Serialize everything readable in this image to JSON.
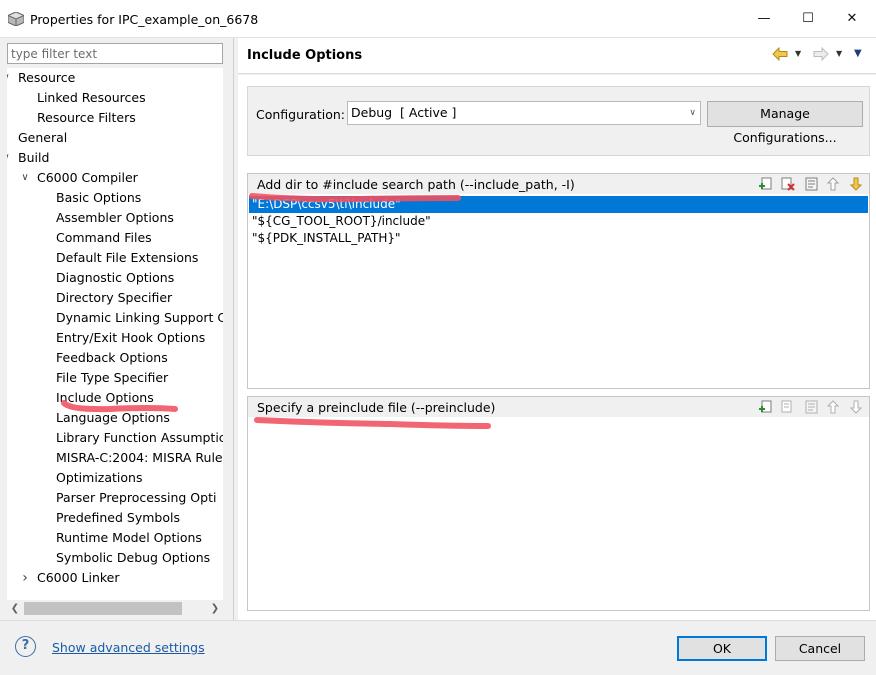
{
  "window": {
    "title": "Properties for IPC_example_on_6678",
    "minimize_glyph": "—",
    "maximize_glyph": "☐",
    "close_glyph": "✕"
  },
  "left": {
    "filter_placeholder": "type filter text",
    "tree": [
      {
        "label": "Resource",
        "level": 0,
        "expander": "expanded"
      },
      {
        "label": "Linked Resources",
        "level": 1,
        "expander": "none"
      },
      {
        "label": "Resource Filters",
        "level": 1,
        "expander": "none"
      },
      {
        "label": "General",
        "level": 0,
        "expander": "none"
      },
      {
        "label": "Build",
        "level": 0,
        "expander": "expanded"
      },
      {
        "label": "C6000 Compiler",
        "level": 1,
        "expander": "expanded"
      },
      {
        "label": "Basic Options",
        "level": 2,
        "expander": "none"
      },
      {
        "label": "Assembler Options",
        "level": 2,
        "expander": "none"
      },
      {
        "label": "Command Files",
        "level": 2,
        "expander": "none"
      },
      {
        "label": "Default File Extensions",
        "level": 2,
        "expander": "none"
      },
      {
        "label": "Diagnostic Options",
        "level": 2,
        "expander": "none"
      },
      {
        "label": "Directory Specifier",
        "level": 2,
        "expander": "none"
      },
      {
        "label": "Dynamic Linking Support C",
        "level": 2,
        "expander": "none"
      },
      {
        "label": "Entry/Exit Hook Options",
        "level": 2,
        "expander": "none"
      },
      {
        "label": "Feedback Options",
        "level": 2,
        "expander": "none"
      },
      {
        "label": "File Type Specifier",
        "level": 2,
        "expander": "none"
      },
      {
        "label": "Include Options",
        "level": 2,
        "expander": "none"
      },
      {
        "label": "Language Options",
        "level": 2,
        "expander": "none"
      },
      {
        "label": "Library Function Assumptic",
        "level": 2,
        "expander": "none"
      },
      {
        "label": "MISRA-C:2004: MISRA Rule",
        "level": 2,
        "expander": "none"
      },
      {
        "label": "Optimizations",
        "level": 2,
        "expander": "none"
      },
      {
        "label": "Parser Preprocessing Opti",
        "level": 2,
        "expander": "none"
      },
      {
        "label": "Predefined Symbols",
        "level": 2,
        "expander": "none"
      },
      {
        "label": "Runtime Model Options",
        "level": 2,
        "expander": "none"
      },
      {
        "label": "Symbolic Debug Options",
        "level": 2,
        "expander": "none"
      },
      {
        "label": "C6000 Linker",
        "level": 1,
        "expander": "collapsed"
      }
    ]
  },
  "right": {
    "page_title": "Include Options",
    "configuration": {
      "label": "Configuration:",
      "value": "Debug  [ Active ]",
      "manage_label": "Manage Configurations..."
    },
    "include_paths": {
      "title": "Add dir to #include search path (--include_path, -I)",
      "items": [
        "\"E:\\DSP\\ccsv5\\ti\\include\"",
        "\"${CG_TOOL_ROOT}/include\"",
        "\"${PDK_INSTALL_PATH}\""
      ],
      "selected_index": 0
    },
    "preinclude": {
      "title": "Specify a preinclude file (--preinclude)",
      "items": []
    }
  },
  "bottom": {
    "help_glyph": "?",
    "advanced_link": "Show advanced settings",
    "ok_label": "OK",
    "cancel_label": "Cancel"
  },
  "colors": {
    "selection": "#0078d7",
    "link": "#1a5ba6",
    "annotation_marker": "#f25060"
  }
}
